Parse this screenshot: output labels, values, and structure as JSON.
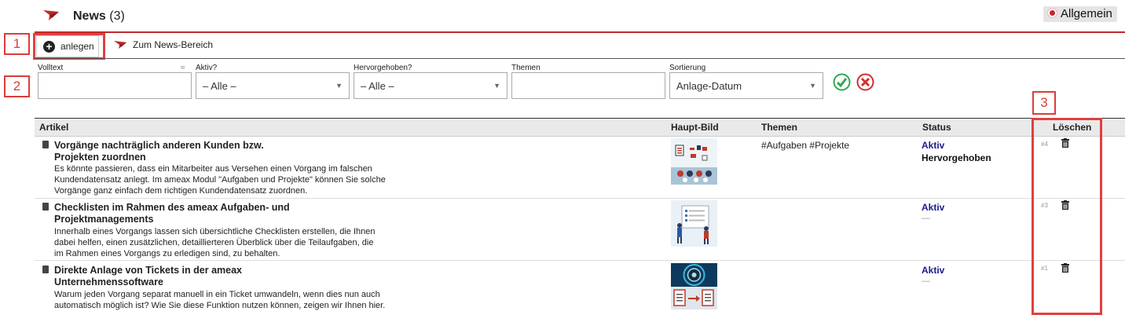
{
  "header": {
    "title": "News",
    "count": "(3)",
    "module_badge": "Allgemein"
  },
  "toolbar": {
    "create_label": "anlegen",
    "news_area_label": "Zum News-Bereich"
  },
  "markers": [
    "1",
    "2",
    "3"
  ],
  "filters": {
    "volltext_label": "Volltext",
    "volltext_hint": "≈",
    "aktiv_label": "Aktiv?",
    "aktiv_value": "– Alle –",
    "hervorgehoben_label": "Hervorgehoben?",
    "hervorgehoben_value": "– Alle –",
    "themen_label": "Themen",
    "sortierung_label": "Sortierung",
    "sortierung_value": "Anlage-Datum"
  },
  "table": {
    "columns": [
      "Artikel",
      "Haupt-Bild",
      "Themen",
      "Status",
      "Löschen"
    ],
    "rows": [
      {
        "title": "Vorgänge nachträglich anderen Kunden bzw. Projekten zuordnen",
        "title_line1": "Vorgänge nachträglich anderen Kunden bzw.",
        "title_line2": "Projekten zuordnen",
        "desc1": "Es könnte passieren, dass ein Mitarbeiter aus Versehen einen Vorgang im falschen",
        "desc2": "Kundendatensatz anlegt. Im ameax Modul \"Aufgaben und Projekte\" können Sie solche",
        "desc3": "Vorgänge ganz einfach dem richtigen Kundendatensatz zuordnen.",
        "themen": "#Aufgaben #Projekte",
        "status": "Aktiv",
        "status2": "Hervorgehoben",
        "id": "#4"
      },
      {
        "title_line1": "Checklisten im Rahmen des ameax Aufgaben- und",
        "title_line2": "Projektmanagements",
        "desc1": "Innerhalb eines Vorgangs lassen sich übersichtliche Checklisten erstellen, die Ihnen",
        "desc2": "dabei helfen, einen zusätzlichen, detaillierteren Überblick über die Teilaufgaben, die",
        "desc3": "im Rahmen eines Vorgangs zu erledigen sind, zu behalten.",
        "themen": "",
        "status": "Aktiv",
        "status2": "—",
        "id": "#3"
      },
      {
        "title_line1": "Direkte Anlage von Tickets in der ameax",
        "title_line2": "Unternehmenssoftware",
        "desc1": "Warum jeden Vorgang separat manuell in ein Ticket umwandeln, wenn dies nun auch",
        "desc2": "automatisch möglich ist? Wie Sie diese Funktion nutzen können, zeigen wir Ihnen hier.",
        "desc3": "",
        "themen": "",
        "status": "Aktiv",
        "status2": "—",
        "id": "#1"
      }
    ]
  },
  "colors": {
    "accent_red": "#c0282c",
    "marker_red": "#e03a3a",
    "status_blue": "#1b1b8c",
    "ok_green": "#2fa84f"
  },
  "icons": [
    "paper-plane-icon",
    "add-circle-icon",
    "paper-plane-icon",
    "checkmark-icon",
    "cancel-icon",
    "document-icon",
    "trash-icon"
  ]
}
